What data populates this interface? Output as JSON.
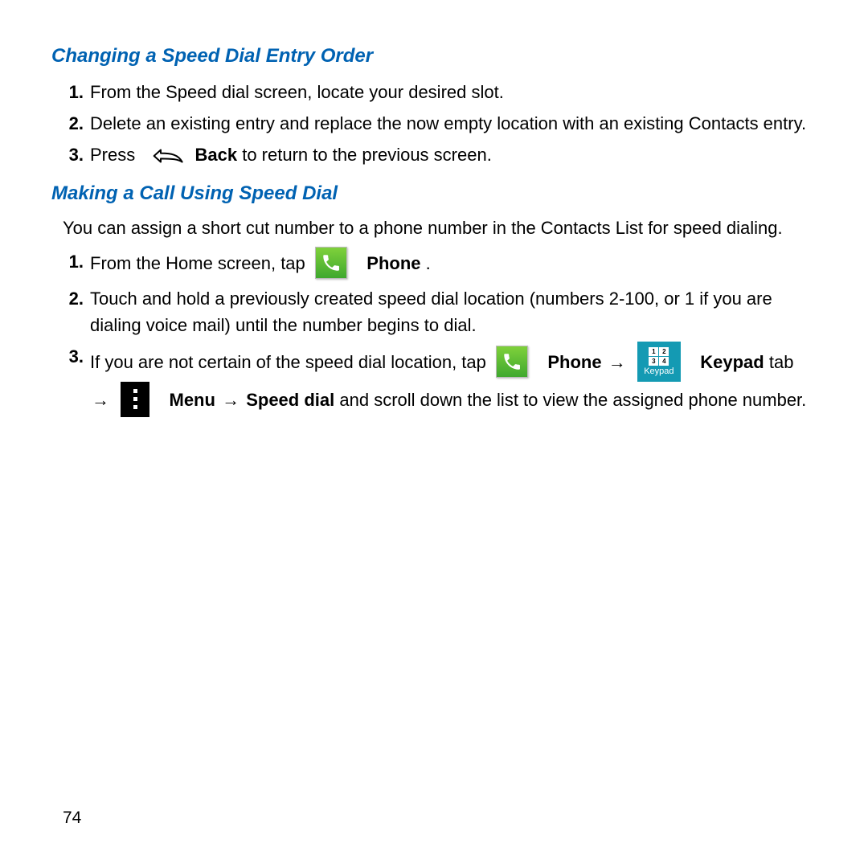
{
  "section1": {
    "heading": "Changing a Speed Dial Entry Order",
    "steps": [
      {
        "num": "1.",
        "text": "From the Speed dial screen, locate your desired slot."
      },
      {
        "num": "2.",
        "text": "Delete an existing entry and replace the now empty location with an existing Contacts entry."
      },
      {
        "num": "3.",
        "pre": "Press ",
        "bold": "Back",
        "post": " to return to the previous screen."
      }
    ]
  },
  "section2": {
    "heading": "Making a Call Using Speed Dial",
    "intro": "You can assign a short cut number to a phone number in the Contacts List for speed dialing.",
    "steps": {
      "s1": {
        "num": "1.",
        "pre": "From the Home screen, tap ",
        "bold": "Phone",
        "post": "."
      },
      "s2": {
        "num": "2.",
        "text": "Touch and hold a previously created speed dial location (numbers 2-100, or 1 if you are dialing voice mail) until the number begins to dial."
      },
      "s3": {
        "num": "3.",
        "pre": "If you are not certain of the speed dial location, tap ",
        "phone_bold": "Phone",
        "arrow1": " → ",
        "keypad_bold": "Keypad",
        "tab_word": " tab ",
        "arrow2": "→ ",
        "menu_bold": "Menu",
        "arrow3": " → ",
        "speeddial_bold": "Speed dial",
        "post": " and scroll down the list to view the assigned phone number."
      }
    }
  },
  "keypad": {
    "c1": "1",
    "c2": "2",
    "c3": "3",
    "c4": "4",
    "label": "Keypad"
  },
  "page_number": "74"
}
